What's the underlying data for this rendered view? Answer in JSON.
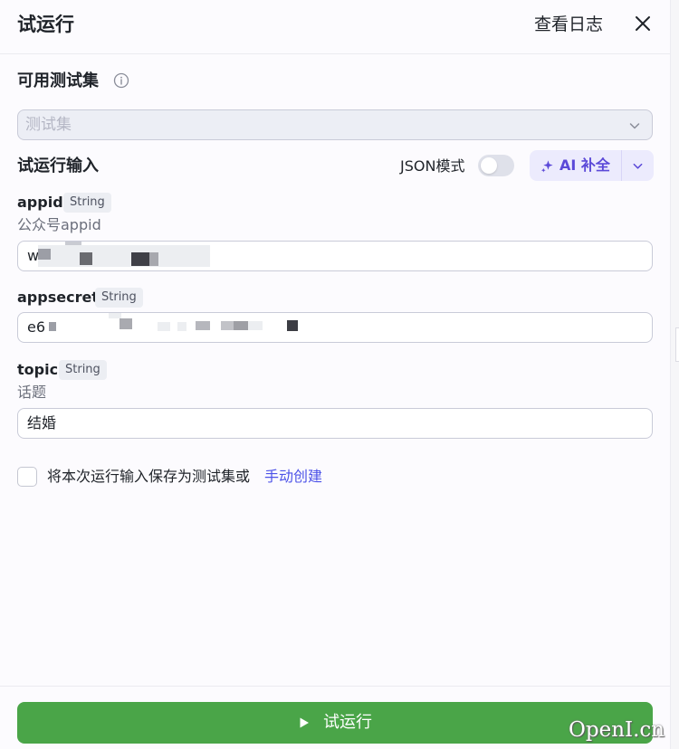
{
  "header": {
    "title": "试运行",
    "view_logs_label": "查看日志",
    "close_icon": "close-icon"
  },
  "test_set": {
    "section_title": "可用测试集",
    "info_icon": "info-icon",
    "placeholder": "测试集",
    "chevron_icon": "chevron-down-icon"
  },
  "run_input": {
    "section_title": "试运行输入",
    "json_mode_label": "JSON模式",
    "json_mode_on": false,
    "ai_complete_label": "AI 补全",
    "ai_icon": "sparkle-icon"
  },
  "fields": [
    {
      "name": "appid",
      "type": "String",
      "description": "公众号appid",
      "value": "w"
    },
    {
      "name": "appsecret",
      "type": "String",
      "value": "e6"
    },
    {
      "name": "topic",
      "type": "String",
      "description": "话题",
      "value": "结婚"
    }
  ],
  "save_option": {
    "checked": false,
    "text": "将本次运行输入保存为测试集或",
    "link_label": "手动创建"
  },
  "footer": {
    "run_label": "试运行",
    "play_icon": "play-icon"
  },
  "watermark": "OpenI.cn",
  "colors": {
    "accent": "#4d53e8",
    "run_button": "#4aa548",
    "ai_text": "#5b49d8"
  }
}
